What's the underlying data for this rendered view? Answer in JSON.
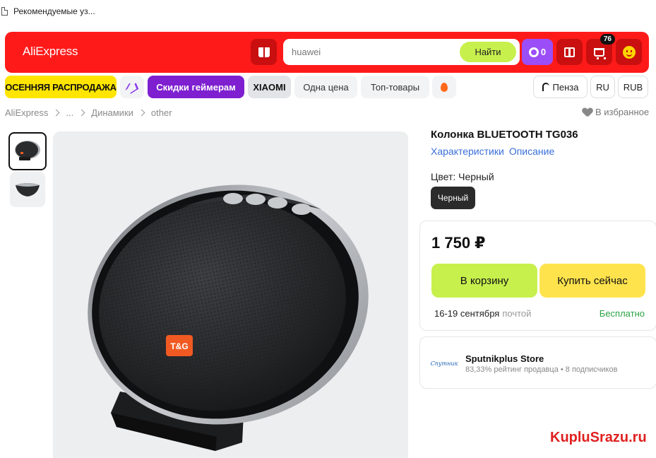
{
  "browser": {
    "tab_title": "Рекомендуемые уз..."
  },
  "header": {
    "logo": "AliExpress",
    "search_value": "huawei",
    "search_button": "Найти",
    "coins": "0",
    "cart_count": "76"
  },
  "pills": {
    "sale": "ОСЕННЯЯ РАСПРОДАЖА",
    "gamers": "Скидки геймерам",
    "xiaomi": "XIAOMI",
    "one_price": "Одна цена",
    "top": "Топ-товары",
    "city": "Пенза",
    "lang": "RU",
    "currency": "RUB"
  },
  "breadcrumb": {
    "items": [
      "AliExpress",
      "...",
      "Динамики",
      "other"
    ],
    "favorite": "В избранное"
  },
  "product": {
    "title": "Колонка BLUETOOTH TG036",
    "link_specs": "Характеристики",
    "link_desc": "Описание",
    "color_label": "Цвет: Черный",
    "color_option": "Черный",
    "price": "1 750 ₽",
    "add_to_cart": "В корзину",
    "buy_now": "Купить сейчас",
    "delivery_date": "16-19 сентября",
    "delivery_method": "почтой",
    "delivery_cost": "Бесплатно",
    "brand_logo": "T&G"
  },
  "store": {
    "logo_text": "Спутник",
    "name": "Sputnikplus Store",
    "meta": "83,33% рейтинг продавца • 8 подписчиков"
  },
  "watermark": "KupluSrazu.ru",
  "colors": {
    "brand_red": "#ff1a1a",
    "accent_lime": "#c7f04d",
    "accent_yellow": "#ffe34d",
    "gamers_purple": "#7e1fd0",
    "link_blue": "#3a6fd8",
    "free_green": "#2aa345"
  }
}
